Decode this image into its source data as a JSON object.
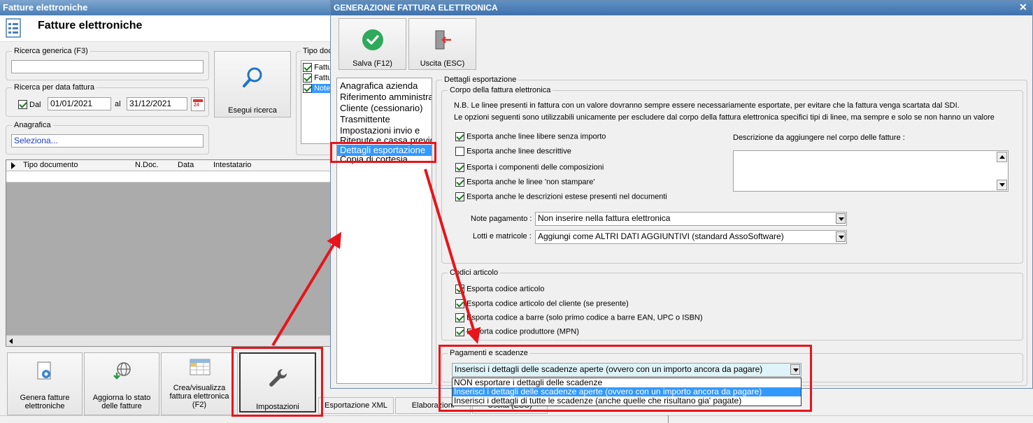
{
  "main_window": {
    "title": "Fatture elettroniche",
    "header_title": "Fatture elettroniche",
    "search_group_label": "Ricerca generica (F3)",
    "search_value": "",
    "date_group_label": "Ricerca per data fattura",
    "date_from_label": "Dal",
    "date_from": "01/01/2021",
    "date_to_label": "al",
    "date_to": "31/12/2021",
    "calendar_day": "24",
    "search_button": "Esegui ricerca",
    "anagrafica_label": "Anagrafica",
    "anagrafica_value": "Seleziona...",
    "tipo_doc_label": "Tipo doc",
    "tipo_doc_items": [
      "Fattu",
      "Fattu",
      "Note"
    ],
    "grid_columns": [
      "Tipo documento",
      "N.Doc.",
      "Data",
      "Intestatario"
    ],
    "bottom_buttons": [
      {
        "label": "Genera fatture\nelettroniche",
        "icon": "gear-document-icon"
      },
      {
        "label": "Aggiorna lo stato\ndelle fatture",
        "icon": "globe-download-icon"
      },
      {
        "label": "Crea/visualizza\nfattura elettronica\n(F2)",
        "icon": "table-icon"
      },
      {
        "label": "Impostazioni",
        "icon": "wrench-icon"
      }
    ],
    "bottom_tabs": [
      "Esportazione XML",
      "Elaborazioni",
      "Uscita (ESC)"
    ]
  },
  "dialog": {
    "title": "GENERAZIONE FATTURA ELETTRONICA",
    "save_label": "Salva (F12)",
    "exit_label": "Uscita (ESC)",
    "nav_items": [
      "Anagrafica azienda",
      "Riferimento amministrazione",
      "Cliente (cessionario)",
      "Trasmittente",
      "Impostazioni invio e",
      "Ritenute e cassa previdenziale",
      "Dettagli esportazione",
      "Copia di cortesia"
    ],
    "selected_nav": "Dettagli esportazione",
    "details_group": "Dettagli esportazione",
    "body_group": "Corpo della fattura elettronica",
    "note_line1": "N.B. Le linee presenti in fattura con un valore dovranno sempre essere necessariamente esportate, per evitare che la fattura venga scartata dal SDI.",
    "note_line2": "Le opzioni seguenti sono utilizzabili unicamente per escludere dal corpo della fattura elettronica specifici tipi di linee, ma sempre e solo se non hanno un valore",
    "body_checks": [
      {
        "label": "Esporta anche linee libere senza importo",
        "checked": true
      },
      {
        "label": "Esporta anche linee descrittive",
        "checked": false
      },
      {
        "label": "Esporta i componenti delle composizioni",
        "checked": true
      },
      {
        "label": "Esporta anche le linee 'non stampare'",
        "checked": true
      },
      {
        "label": "Esporta anche le descrizioni estese presenti nel documenti",
        "checked": true
      }
    ],
    "desc_label": "Descrizione da aggiungere nel corpo delle fatture :",
    "note_pagamento_label": "Note pagamento :",
    "note_pagamento_value": "Non inserire nella fattura elettronica",
    "lotti_label": "Lotti e matricole :",
    "lotti_value": "Aggiungi come ALTRI DATI AGGIUNTIVI (standard AssoSoftware)",
    "codici_group": "Codici articolo",
    "codici_checks": [
      {
        "label": "Esporta codice articolo",
        "checked": true
      },
      {
        "label": "Esporta codice articolo del cliente (se presente)",
        "checked": true
      },
      {
        "label": "Esporta codice a barre (solo primo codice a barre EAN, UPC o ISBN)",
        "checked": true
      },
      {
        "label": "Esporta codice produttore (MPN)",
        "checked": true
      }
    ],
    "pagamenti_group": "Pagamenti e scadenze",
    "pagamenti_value": "Inserisci i dettagli delle scadenze aperte (ovvero con un importo ancora da pagare)",
    "pagamenti_options": [
      "NON esportare i dettagli delle scadenze",
      "Inserisci i dettagli delle scadenze aperte (ovvero con un importo ancora da pagare)",
      "Inserisci i dettagli di tutte le scadenze (anche quelle che risultano gia' pagate)"
    ],
    "pagamenti_selected_index": 1
  },
  "colors": {
    "titlebar": "#4a7fb5",
    "annotation_red": "#e8141b",
    "selection_blue": "#3399ff",
    "save_green": "#2eaa5a"
  }
}
